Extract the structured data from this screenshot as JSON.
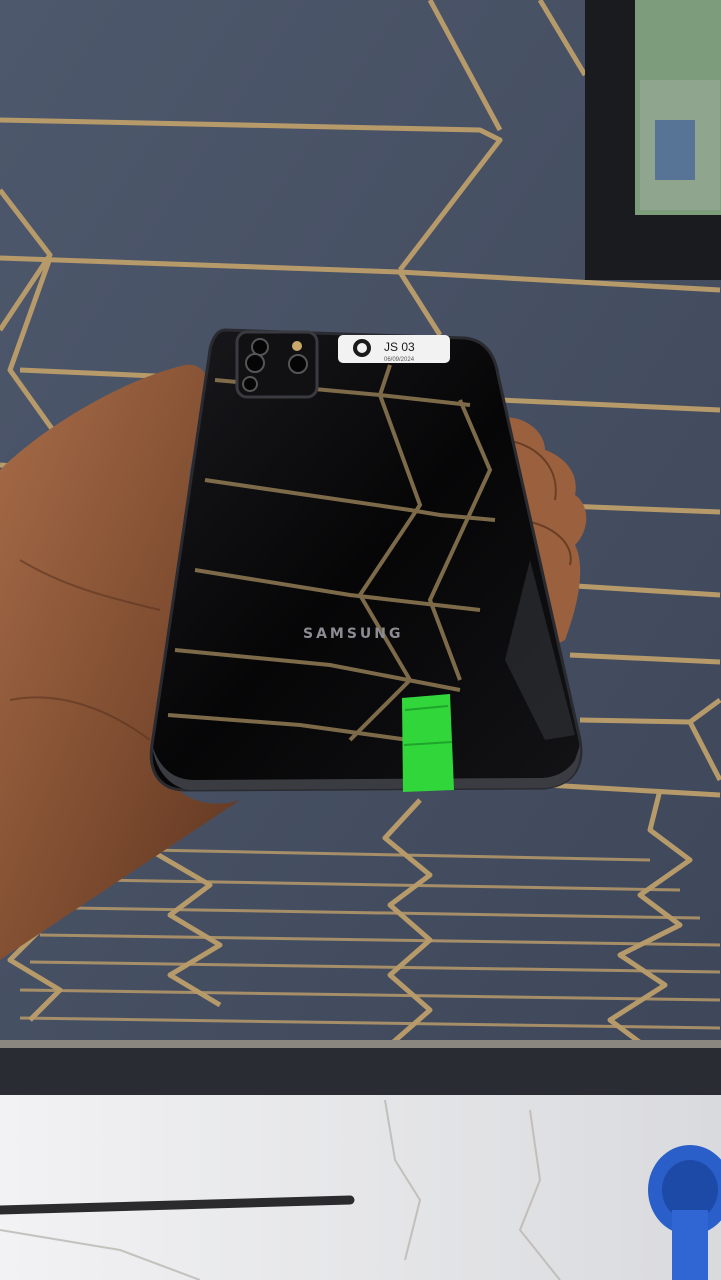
{
  "photo": {
    "phone": {
      "brand": "SAMSUNG",
      "label_code": "JS 03",
      "label_subtext": "06/09/2024"
    },
    "colors": {
      "wall": "#4a5468",
      "wall_dark": "#3c4558",
      "trim_gold": "#b79a6a",
      "phone_body": "#0b0b0d",
      "skin": "#8a5638",
      "tape": "#2fd63a",
      "floor": "#e6e6e8"
    }
  }
}
